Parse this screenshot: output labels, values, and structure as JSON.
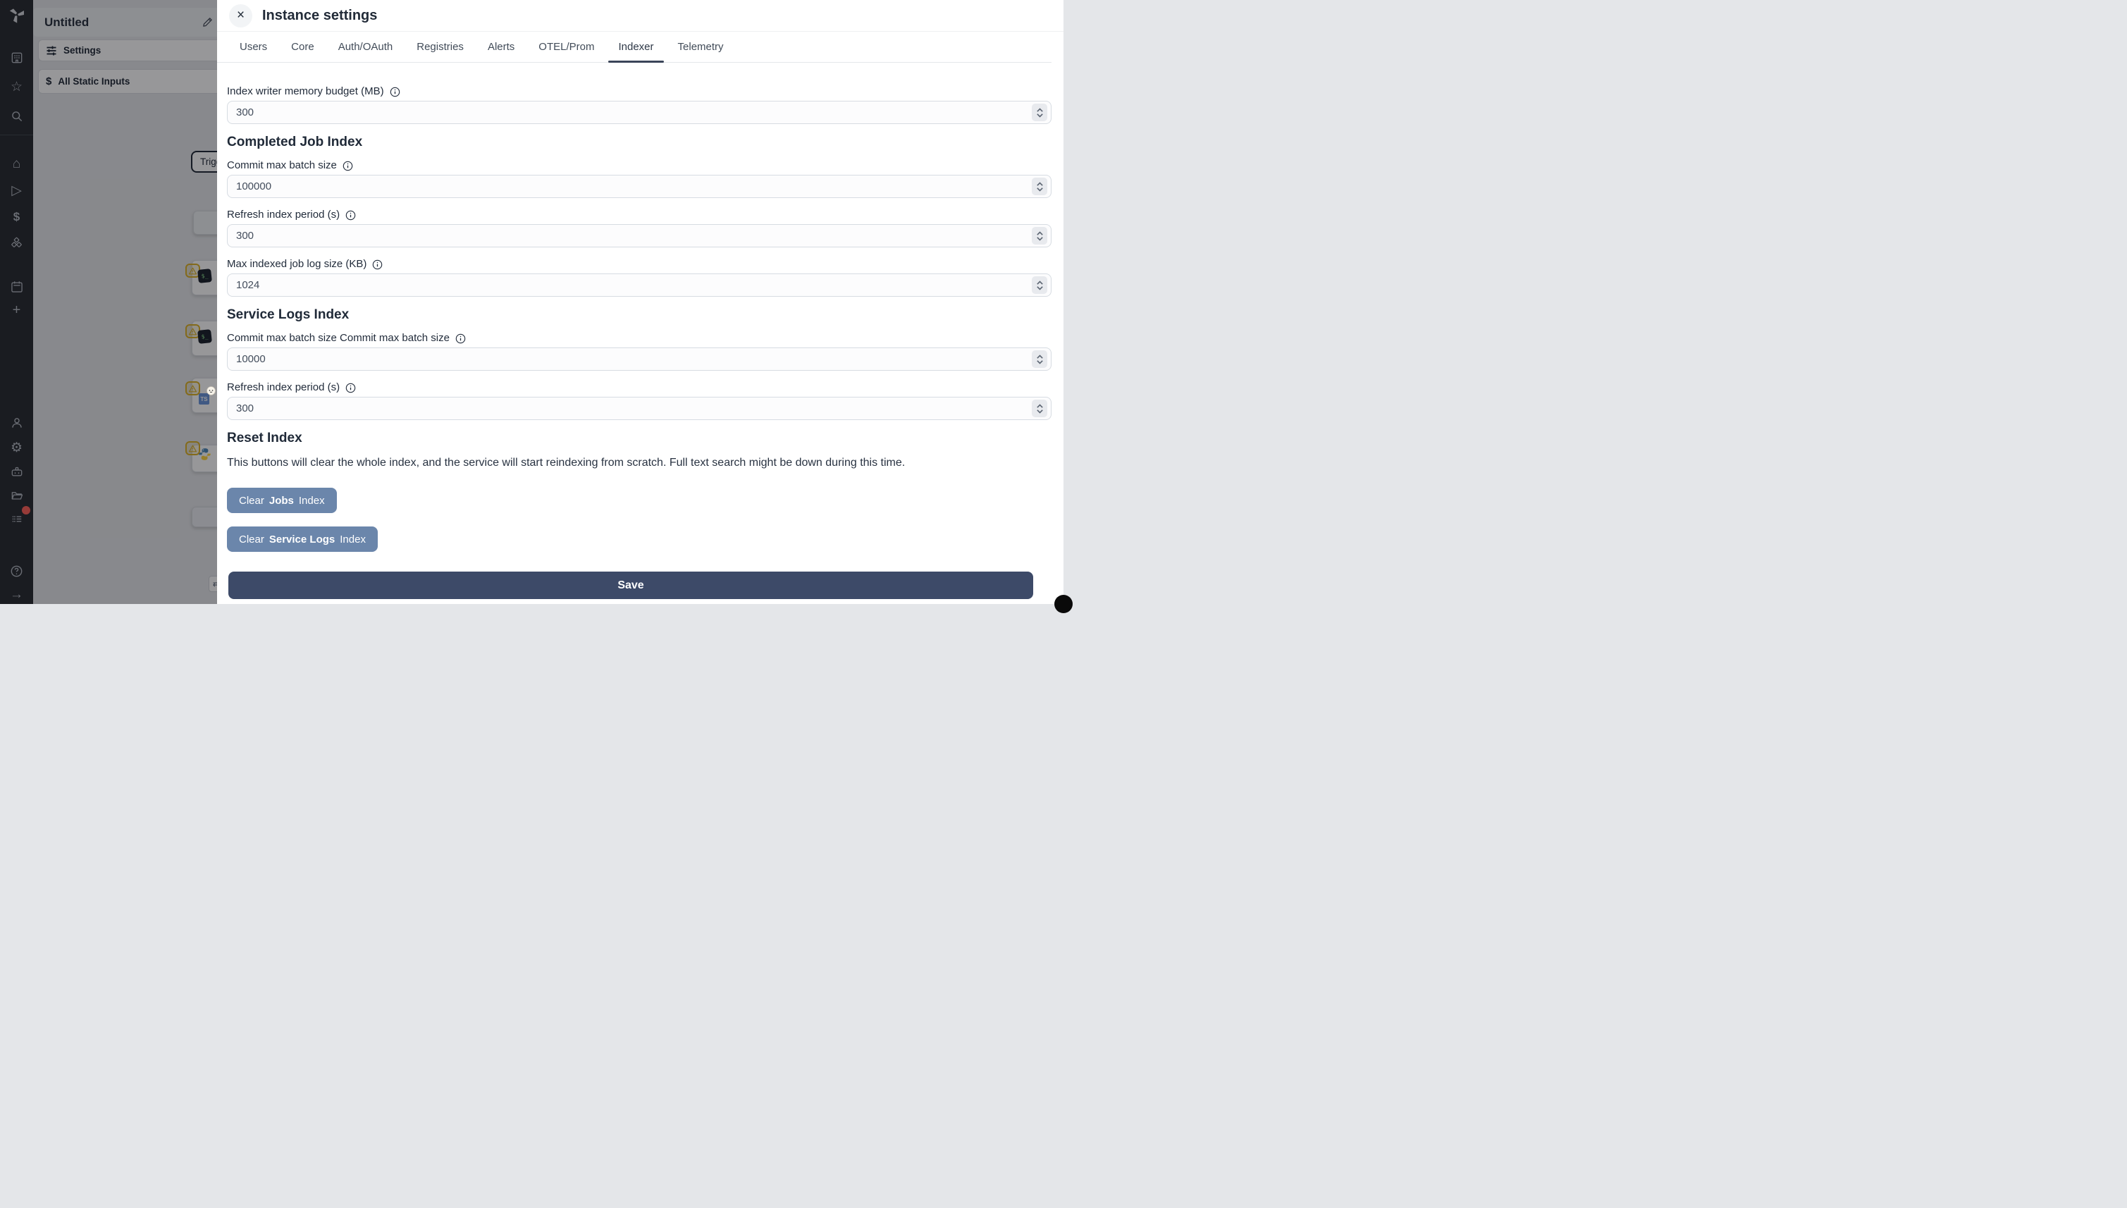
{
  "colors": {
    "clear_button": "#6b86ab",
    "save_button": "#3d4a68",
    "active_tab_underline": "#3a4458",
    "warning_badge": "#dcaf1e",
    "notification_dot": "#ff5a52"
  },
  "sidebar": {
    "logo": "windmill-logo",
    "glyphs": {
      "star": "☆",
      "home": "⌂",
      "play": "▷",
      "dollar": "$",
      "plus": "+",
      "gear": "⚙",
      "arrow_right": "→",
      "help": "?"
    }
  },
  "background": {
    "untitled_title": "Untitled",
    "settings_item": "Settings",
    "static_inputs_item": "All Static Inputs",
    "static_inputs_icon": "$",
    "trigger_node_label": "Trigg",
    "bash_icon_text": "$_",
    "ts_icon_text": "TS",
    "collapse_button_glyph": "⇄"
  },
  "modal": {
    "close_glyph": "×",
    "title": "Instance settings",
    "active_tab": "Indexer",
    "tabs": [
      "Users",
      "Core",
      "Auth/OAuth",
      "Registries",
      "Alerts",
      "OTEL/Prom",
      "Indexer",
      "Telemetry"
    ],
    "index_writer": {
      "label": "Index writer memory budget (MB)",
      "value": "300"
    },
    "completed_job_index": {
      "heading": "Completed Job Index",
      "commit_max_batch_size": {
        "label": "Commit max batch size",
        "value": "100000"
      },
      "refresh_index_period": {
        "label": "Refresh index period (s)",
        "value": "300"
      },
      "max_indexed_job_log_size": {
        "label": "Max indexed job log size (KB)",
        "value": "1024"
      }
    },
    "service_logs_index": {
      "heading": "Service Logs Index",
      "commit_max_batch_size": {
        "label": "Commit max batch size Commit max batch size",
        "value": "10000"
      },
      "refresh_index_period": {
        "label": "Refresh index period (s)",
        "value": "300"
      }
    },
    "reset_index": {
      "heading": "Reset Index",
      "description": "This buttons will clear the whole index, and the service will start reindexing from scratch. Full text search might be down during this time.",
      "clear_jobs": {
        "pre": "Clear",
        "target": "Jobs",
        "post": "Index"
      },
      "clear_service_logs": {
        "pre": "Clear",
        "target": "Service Logs",
        "post": "Index"
      }
    },
    "save_label": "Save"
  }
}
